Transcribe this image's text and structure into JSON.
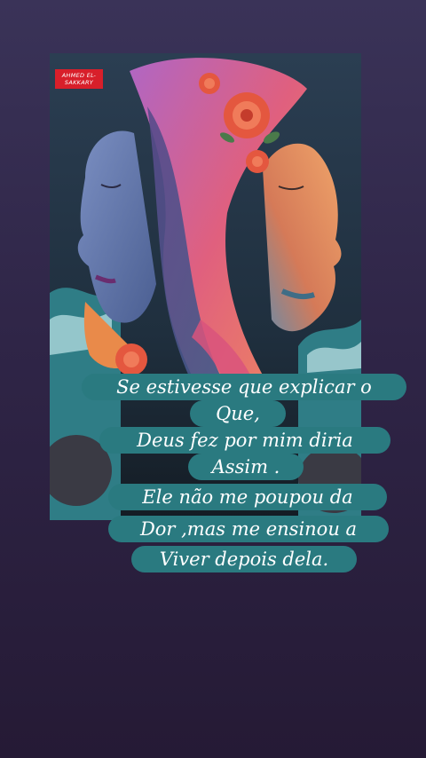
{
  "artwork": {
    "watermark": "AHMED EL-SAKKARY",
    "colors": {
      "background": "#1d2a36",
      "face_left": "#5b7aa8",
      "face_right": "#e08a5a",
      "swirl_purple": "#7a4c9a",
      "swirl_pink": "#d9547c",
      "rose": "#e4573f",
      "wave": "#2f7d86"
    }
  },
  "caption": {
    "lines": [
      "Se estivesse que explicar o",
      "Que,",
      "Deus fez por mim diria",
      "Assim .",
      "Ele não me poupou da",
      "Dor ,mas me ensinou a",
      "Viver depois dela."
    ],
    "bubble_color": "#2a7a80",
    "text_color": "#ffffff"
  }
}
